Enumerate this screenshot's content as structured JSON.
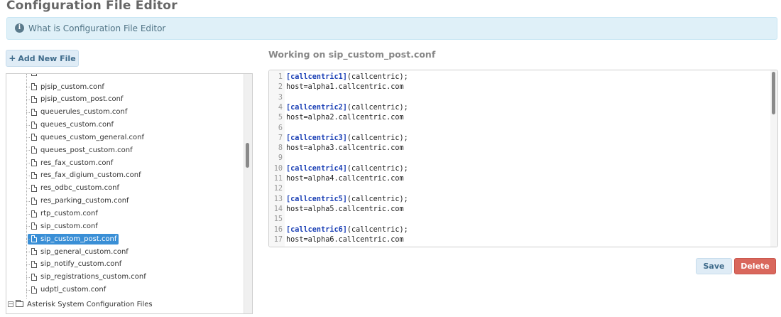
{
  "page": {
    "title": "Configuration File Editor"
  },
  "info_banner": {
    "icon": "info-icon",
    "text": "What is Configuration File Editor"
  },
  "toolbar": {
    "add_label": "Add New File"
  },
  "tree": {
    "items": [
      {
        "label": "pjsip_custom.conf"
      },
      {
        "label": "pjsip_custom_post.conf"
      },
      {
        "label": "queuerules_custom.conf"
      },
      {
        "label": "queues_custom.conf"
      },
      {
        "label": "queues_custom_general.conf"
      },
      {
        "label": "queues_post_custom.conf"
      },
      {
        "label": "res_fax_custom.conf"
      },
      {
        "label": "res_fax_digium_custom.conf"
      },
      {
        "label": "res_odbc_custom.conf"
      },
      {
        "label": "res_parking_custom.conf"
      },
      {
        "label": "rtp_custom.conf"
      },
      {
        "label": "sip_custom.conf"
      },
      {
        "label": "sip_custom_post.conf",
        "selected": true
      },
      {
        "label": "sip_general_custom.conf"
      },
      {
        "label": "sip_notify_custom.conf"
      },
      {
        "label": "sip_registrations_custom.conf"
      },
      {
        "label": "udptl_custom.conf"
      }
    ],
    "folder": {
      "label": "Asterisk System Configuration Files"
    }
  },
  "editor": {
    "heading": "Working on sip_custom_post.conf",
    "lines": [
      {
        "num": "1",
        "kw": "[callcentric1]",
        "rest": "(callcentric);"
      },
      {
        "num": "2",
        "kw": "",
        "rest": "host=alpha1.callcentric.com"
      },
      {
        "num": "3",
        "kw": "",
        "rest": ""
      },
      {
        "num": "4",
        "kw": "[callcentric2]",
        "rest": "(callcentric);"
      },
      {
        "num": "5",
        "kw": "",
        "rest": "host=alpha2.callcentric.com"
      },
      {
        "num": "6",
        "kw": "",
        "rest": ""
      },
      {
        "num": "7",
        "kw": "[callcentric3]",
        "rest": "(callcentric);"
      },
      {
        "num": "8",
        "kw": "",
        "rest": "host=alpha3.callcentric.com"
      },
      {
        "num": "9",
        "kw": "",
        "rest": ""
      },
      {
        "num": "10",
        "kw": "[callcentric4]",
        "rest": "(callcentric);"
      },
      {
        "num": "11",
        "kw": "",
        "rest": "host=alpha4.callcentric.com"
      },
      {
        "num": "12",
        "kw": "",
        "rest": ""
      },
      {
        "num": "13",
        "kw": "[callcentric5]",
        "rest": "(callcentric);"
      },
      {
        "num": "14",
        "kw": "",
        "rest": "host=alpha5.callcentric.com"
      },
      {
        "num": "15",
        "kw": "",
        "rest": ""
      },
      {
        "num": "16",
        "kw": "[callcentric6]",
        "rest": "(callcentric);"
      },
      {
        "num": "17",
        "kw": "",
        "rest": "host=alpha6.callcentric.com"
      }
    ]
  },
  "actions": {
    "save_label": "Save",
    "delete_label": "Delete"
  },
  "colors": {
    "accent": "#3a8fd6",
    "danger": "#d9675c",
    "keyword": "#1a3fb5",
    "banner_bg": "#dff0f8"
  }
}
